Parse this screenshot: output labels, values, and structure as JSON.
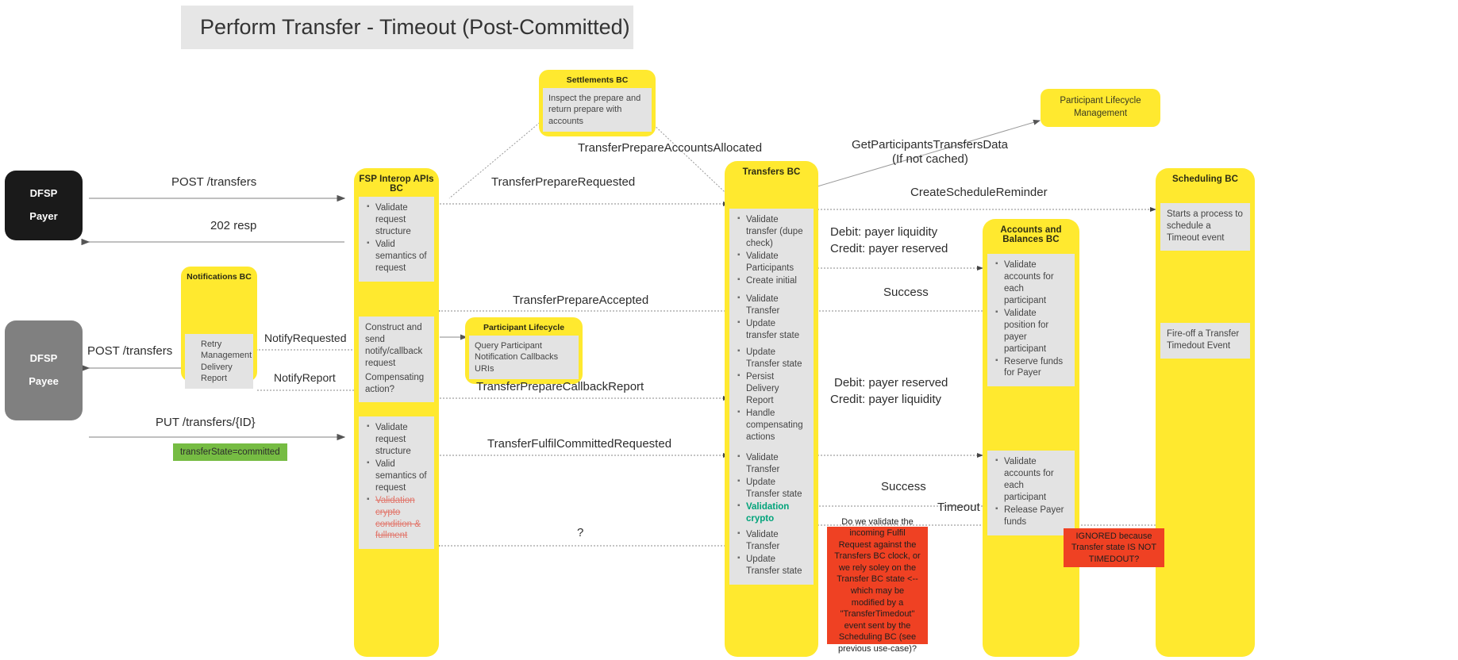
{
  "title": "Perform Transfer - Timeout (Post-Committed)",
  "actors": [
    {
      "name": "payer",
      "line1": "DFSP",
      "line2": "Payer",
      "color": "#1a1a1a"
    },
    {
      "name": "payee",
      "line1": "DFSP",
      "line2": "Payee",
      "color": "#808080"
    }
  ],
  "lanes": [
    {
      "id": "fsp-interop-apis-bc",
      "title": "FSP Interop APIs BC",
      "boxes": [
        {
          "id": "fsp-box-1",
          "items": [
            "Validate request structure",
            "Valid semantics of request"
          ]
        },
        {
          "id": "fsp-box-2",
          "text": "Construct and send notify/callback request"
        },
        {
          "id": "fsp-box-3",
          "text": "Compensating action?"
        },
        {
          "id": "fsp-box-4",
          "items": [
            "Validate request structure",
            "Valid semantics of request"
          ],
          "struck": [
            "Validation crypto condition & fullment"
          ]
        }
      ]
    },
    {
      "id": "transfers-bc",
      "title": "Transfers BC",
      "boxes": [
        {
          "id": "transfers-box-1",
          "items": [
            "Validate transfer (dupe check)",
            "Validate Participants",
            "Create initial state"
          ]
        },
        {
          "id": "transfers-box-2",
          "items": [
            "Validate Transfer",
            "Update transfer state"
          ]
        },
        {
          "id": "transfers-box-3",
          "items": [
            "Update Transfer state",
            "Persist Delivery Report",
            "Handle compensating actions"
          ]
        },
        {
          "id": "transfers-box-4",
          "items": [
            "Validate Transfer",
            "Update Transfer state"
          ],
          "highlighted": [
            "Validation crypto condition & fullment"
          ]
        },
        {
          "id": "transfers-box-5",
          "items": [
            "Validate Transfer",
            "Update Transfer state"
          ]
        }
      ]
    },
    {
      "id": "accounts-and-balances-bc",
      "title": "Accounts and Balances BC",
      "boxes": [
        {
          "id": "ab-box-1",
          "items": [
            "Validate accounts for each participant",
            "Validate position for payer participant",
            "Reserve funds for Payer"
          ]
        },
        {
          "id": "ab-box-2",
          "items": [
            "Validate accounts for each participant",
            "Release Payer funds"
          ]
        }
      ]
    },
    {
      "id": "scheduling-bc",
      "title": "Scheduling BC",
      "boxes": [
        {
          "id": "sched-box-1",
          "text": "Starts a process to schedule a Timeout event"
        },
        {
          "id": "sched-box-2",
          "text": "Fire-off a Transfer Timedout Event"
        }
      ]
    }
  ],
  "notes": [
    {
      "id": "settlements-bc",
      "title": "Settlements BC",
      "body": "Inspect the prepare and return prepare with accounts"
    },
    {
      "id": "notifications-bc",
      "title": "Notifications BC",
      "items": [
        "Retry Management",
        "Delivery Report"
      ]
    },
    {
      "id": "participant-lifecycle",
      "title": "Participant Lifecycle",
      "body": "Query Participant Notification Callbacks URIs"
    },
    {
      "id": "participant-lifecycle-management",
      "text": "Participant Lifecycle Management"
    }
  ],
  "callouts": [
    {
      "id": "fulfil-clock-question",
      "text": "Do we validate the incoming Fulfil Request against the Transfers BC clock, or we rely soley on the Transfer BC state <-- which may be modified by a \"TransferTimedout\" event sent by the Scheduling BC (see previous use-case)?"
    },
    {
      "id": "ignored-timeout",
      "text": "IGNORED because Transfer state IS NOT TIMEDOUT?"
    }
  ],
  "badges": [
    {
      "id": "transfer-state-committed",
      "text": "transferState=committed",
      "color": "#76bc43"
    }
  ],
  "messages": [
    {
      "id": "post-transfers-payer",
      "text": "POST /transfers"
    },
    {
      "id": "resp-202",
      "text": "202 resp"
    },
    {
      "id": "post-transfers-payee",
      "text": "POST /transfers"
    },
    {
      "id": "put-transfers-id",
      "text": "PUT /transfers/{ID}"
    },
    {
      "id": "notify-requested",
      "text": "NotifyRequested"
    },
    {
      "id": "notify-report",
      "text": "NotifyReport"
    },
    {
      "id": "transfer-prepare-requested",
      "text": "TransferPrepareRequested"
    },
    {
      "id": "transfer-prepare-accounts-allocated",
      "text": "TransferPrepareAccountsAllocated"
    },
    {
      "id": "get-participants-transfers-data",
      "text": "GetParticipantsTransfersData"
    },
    {
      "id": "get-participants-transfers-data-sub",
      "text": "(If not cached)"
    },
    {
      "id": "create-schedule-reminder",
      "text": "CreateScheduleReminder"
    },
    {
      "id": "transfer-prepare-accepted",
      "text": "TransferPrepareAccepted"
    },
    {
      "id": "transfer-prepare-callback-report",
      "text": "TransferPrepareCallbackReport"
    },
    {
      "id": "transfer-fulfil-committed-requested",
      "text": "TransferFulfilCommittedRequested"
    },
    {
      "id": "debit-payer-liquidity",
      "text": "Debit: payer liquidity"
    },
    {
      "id": "credit-payer-reserved",
      "text": "Credit: payer reserved"
    },
    {
      "id": "success-1",
      "text": "Success"
    },
    {
      "id": "debit-payer-reserved",
      "text": "Debit: payer reserved"
    },
    {
      "id": "credit-payer-liquidity",
      "text": "Credit: payer liquidity"
    },
    {
      "id": "success-2",
      "text": "Success"
    },
    {
      "id": "timeout",
      "text": "Timeout"
    },
    {
      "id": "question-mark",
      "text": "?"
    }
  ],
  "colors": {
    "lane": "#ffe92f",
    "lane_box": "#e3e3e3",
    "callout_red": "#ef4123",
    "badge_green": "#76bc43",
    "title_banner": "#e6e6e6",
    "strike_red": "#e2776c",
    "highlight_green": "#00a37a"
  }
}
